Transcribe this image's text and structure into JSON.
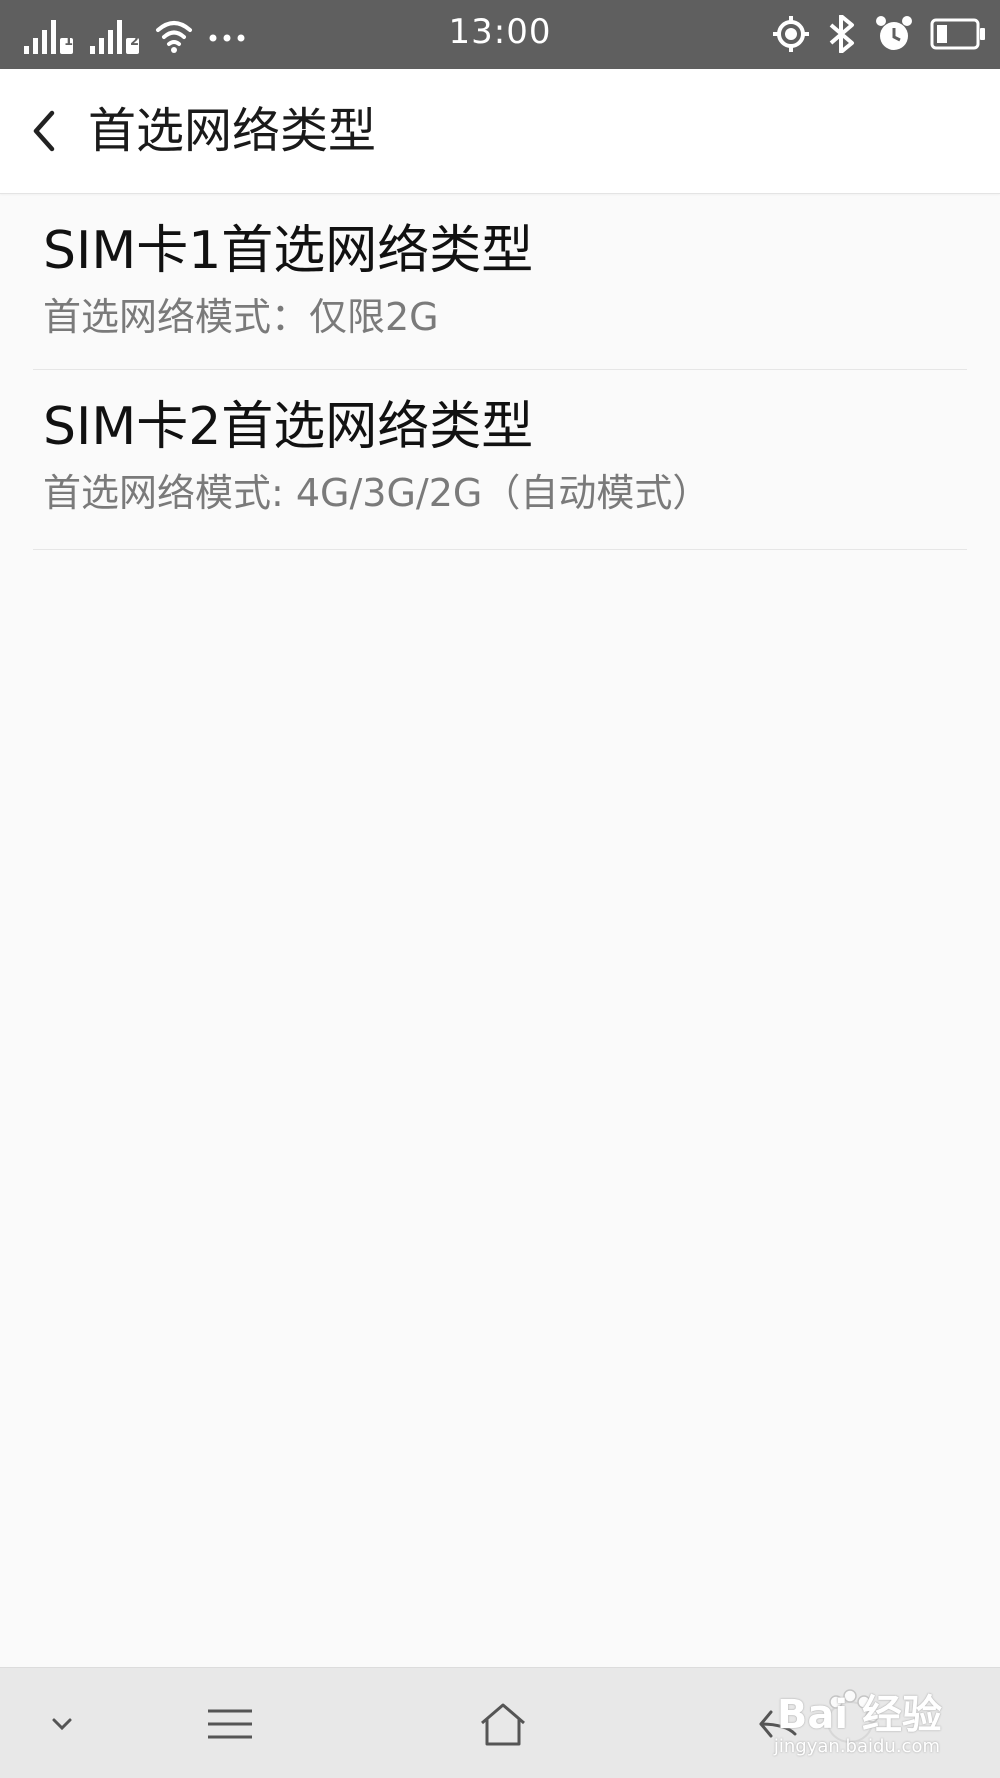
{
  "status_bar": {
    "time": "13:00",
    "sim1_badge": "1",
    "sim2_badge": "2",
    "icons": [
      "signal-icon",
      "signal-icon",
      "wifi-icon",
      "more-dots-icon",
      "location-icon",
      "bluetooth-icon",
      "alarm-icon",
      "battery-icon"
    ]
  },
  "header": {
    "title": "首选网络类型"
  },
  "list": {
    "items": [
      {
        "title": "SIM卡1首选网络类型",
        "subtitle": "首选网络模式：仅限2G"
      },
      {
        "title": "SIM卡2首选网络类型",
        "subtitle": "首选网络模式: 4G/3G/2G（自动模式）"
      }
    ]
  },
  "watermark": {
    "brand": "Bai  经验",
    "url": "jingyan.baidu.com"
  },
  "colors": {
    "status_bar_bg": "#5f5f5f",
    "page_bg": "#fafafa",
    "header_bg": "#ffffff",
    "nav_bar_bg": "#e8e8e8",
    "title_text": "#111111",
    "subtitle_text": "#7a7a7a"
  }
}
